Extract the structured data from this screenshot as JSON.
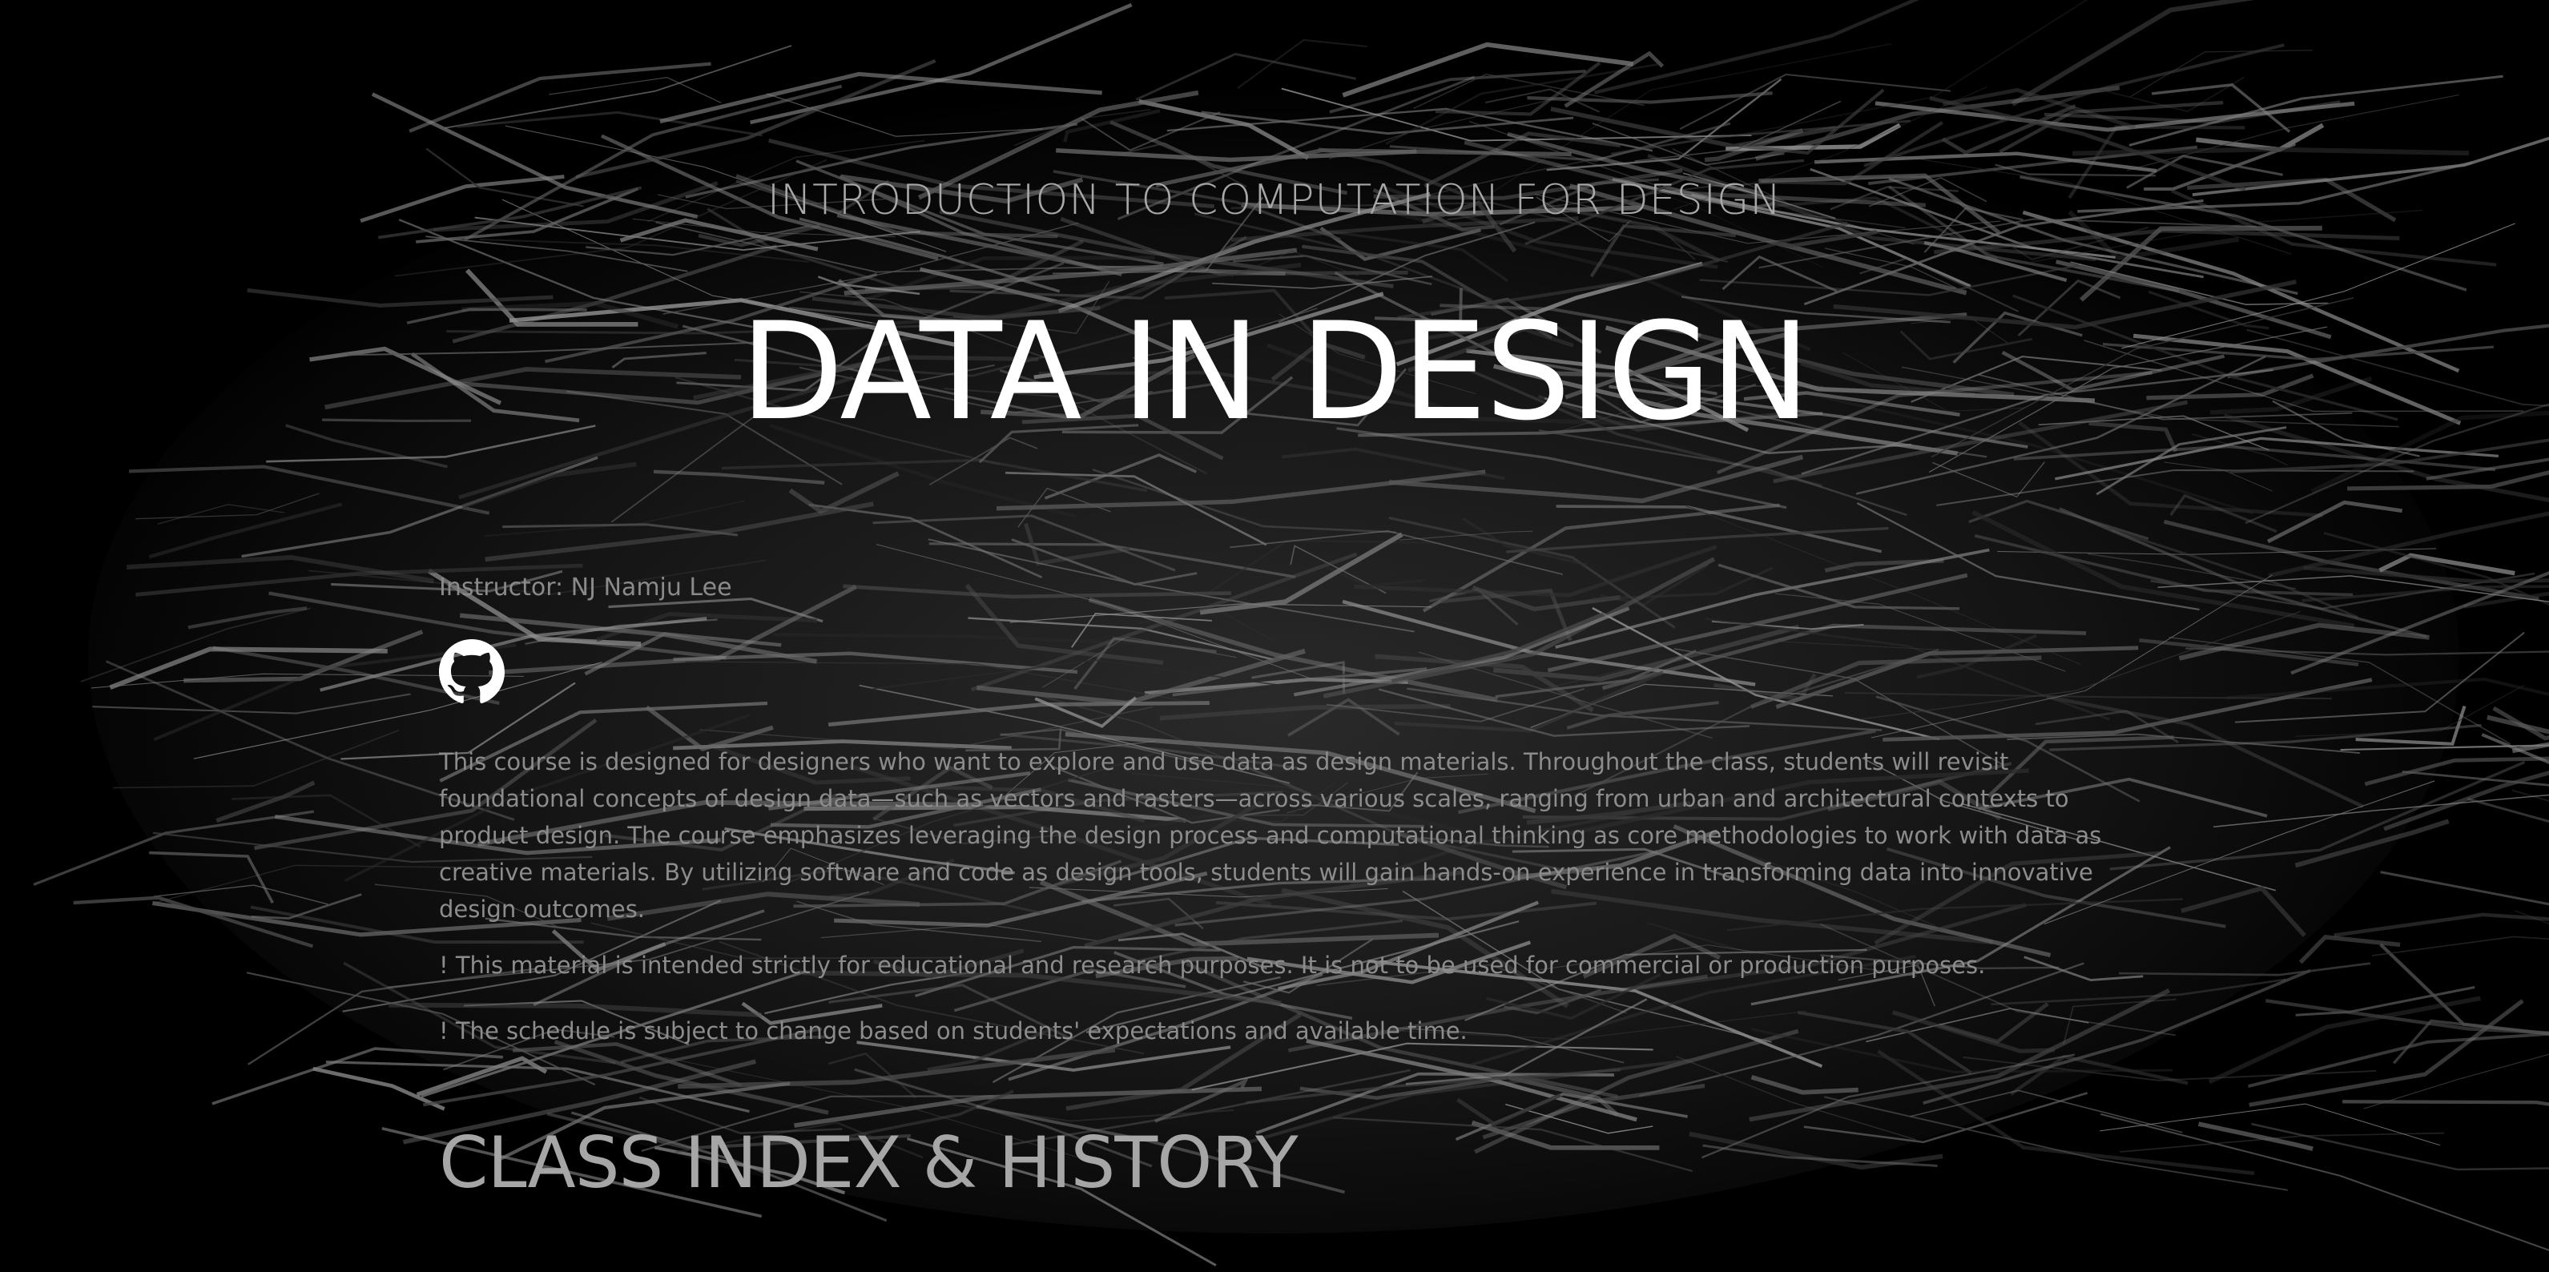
{
  "hero": {
    "subtitle": "INTRODUCTION TO COMPUTATION FOR DESIGN",
    "title": "DATA IN DESIGN"
  },
  "instructor": "Instructor: NJ Namju Lee",
  "links": {
    "github_icon": "github-icon"
  },
  "description": "This course is designed for designers who want to explore and use data as design materials. Throughout the class, students will revisit foundational concepts of design data—such as vectors and rasters—across various scales, ranging from urban and architectural contexts to product design. The course emphasizes leveraging the design process and computational thinking as core methodologies to work with data as creative materials. By utilizing software and code as design tools, students will gain hands-on experience in transforming data into innovative design outcomes.",
  "notes": [
    "! This material is intended strictly for educational and research purposes. It is not to be used for commercial or production purposes.",
    "! The schedule is subject to change based on students' expectations and available time."
  ],
  "section_heading": "CLASS INDEX & HISTORY",
  "colors": {
    "background": "#000000",
    "title": "#ffffff",
    "muted_text": "#8c8c8c"
  }
}
